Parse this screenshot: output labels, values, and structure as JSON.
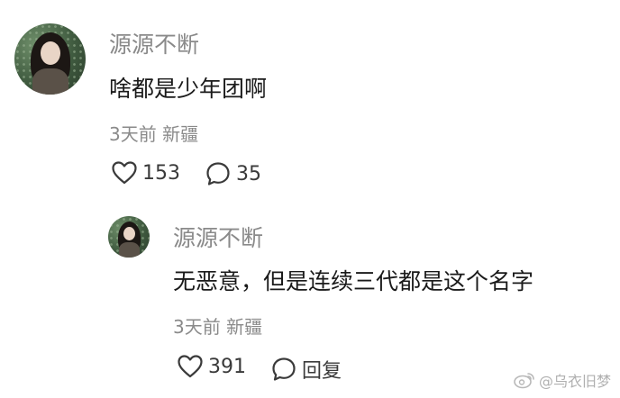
{
  "comment": {
    "username": "源源不断",
    "text": "啥都是少年团啊",
    "meta": "3天前 新疆",
    "likes": "153",
    "replies": "35"
  },
  "reply": {
    "username": "源源不断",
    "text": "无恶意，但是连续三代都是这个名字",
    "meta": "3天前 新疆",
    "likes": "391",
    "reply_label": "回复"
  },
  "watermark": {
    "text": "@乌衣旧梦"
  },
  "icons": {
    "like": "heart-icon",
    "comment": "comment-bubble-icon",
    "weibo": "weibo-logo-icon"
  },
  "colors": {
    "username": "#8a8a8a",
    "text": "#1a1a1a",
    "meta": "#8a8a8a"
  }
}
